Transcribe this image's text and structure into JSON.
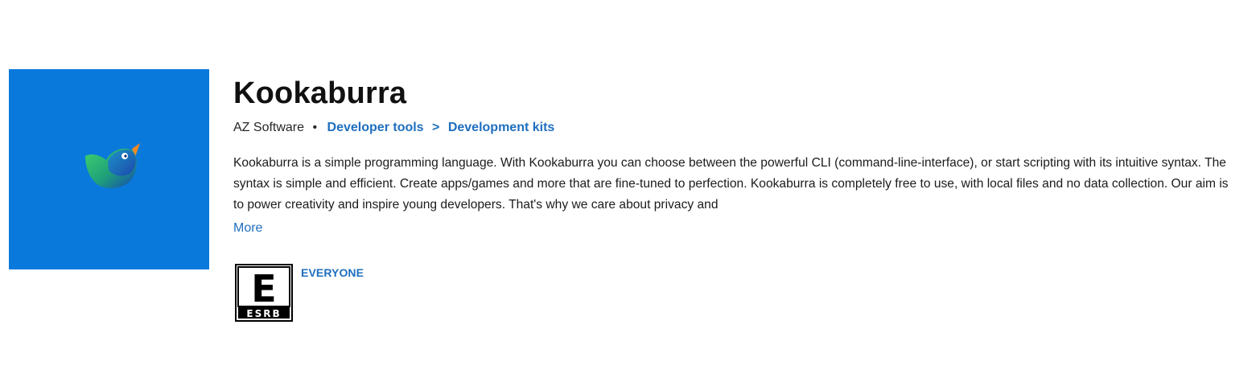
{
  "app": {
    "title": "Kookaburra",
    "publisher": "AZ Software",
    "separator_dot": "•",
    "category": {
      "parent": "Developer tools",
      "separator": ">",
      "child": "Development kits"
    },
    "description": "Kookaburra is a simple programming language. With Kookaburra you can choose between the powerful CLI (command-line-interface), or start scripting with its intuitive syntax. The syntax is simple and efficient. Create apps/games and more that are fine-tuned to perfection. Kookaburra is completely free to use, with local files and no data collection. Our aim is to power creativity and inspire young developers. That's why we care about privacy and",
    "more_label": "More",
    "tile_color": "#0a79dc",
    "logo_icon": "kookaburra-bird-icon"
  },
  "rating": {
    "badge_icon": "esrb-e-rating-icon",
    "badge_letter": "E",
    "badge_text": "ESRB",
    "label": "EVERYONE"
  },
  "colors": {
    "link": "#1f6fbf",
    "text": "#1b1b1b"
  }
}
